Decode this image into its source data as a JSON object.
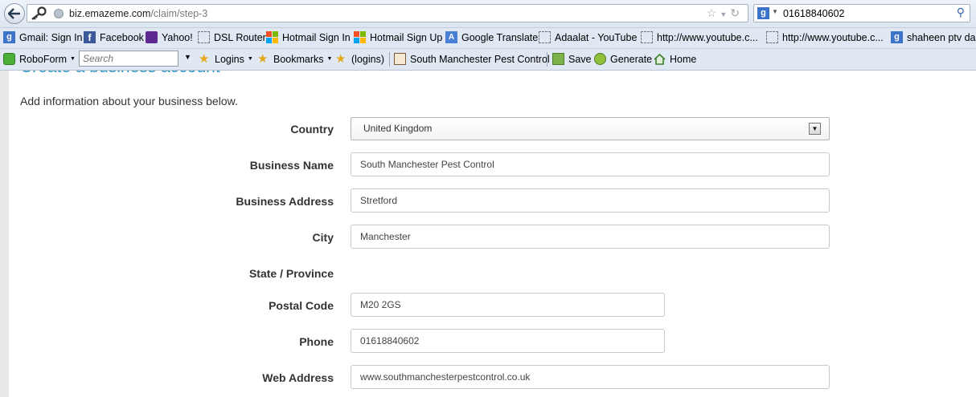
{
  "browser": {
    "url_host": "biz.emazeme.com",
    "url_path": "/claim/step-3",
    "search_value": "01618840602"
  },
  "bookmarks": [
    {
      "label": "Gmail: Sign In",
      "icon": "google-icon"
    },
    {
      "label": "Facebook",
      "icon": "facebook-icon"
    },
    {
      "label": "Yahoo!",
      "icon": "yahoo-icon"
    },
    {
      "label": "DSL Router",
      "icon": "page-icon"
    },
    {
      "label": "Hotmail Sign In",
      "icon": "windows-icon"
    },
    {
      "label": "Hotmail Sign Up",
      "icon": "windows-icon"
    },
    {
      "label": "Google Translate",
      "icon": "translate-icon"
    },
    {
      "label": "Adaalat - YouTube",
      "icon": "page-icon"
    },
    {
      "label": "http://www.youtube.c...",
      "icon": "page-icon"
    },
    {
      "label": "http://www.youtube.c...",
      "icon": "page-icon"
    },
    {
      "label": "shaheen ptv dar",
      "icon": "google-icon"
    }
  ],
  "roboform": {
    "label": "RoboForm",
    "search_placeholder": "Search",
    "logins": "Logins",
    "bookmarks": "Bookmarks",
    "logins_paren": "(logins)",
    "site": "South Manchester Pest Control",
    "save": "Save",
    "generate": "Generate",
    "home": "Home"
  },
  "page": {
    "title": "Create a business account",
    "intro": "Add information about your business below.",
    "fields": {
      "country_label": "Country",
      "country_value": "United Kingdom",
      "business_name_label": "Business Name",
      "business_name_value": "South Manchester Pest Control",
      "business_address_label": "Business Address",
      "business_address_value": "Stretford",
      "city_label": "City",
      "city_value": "Manchester",
      "state_label": "State / Province",
      "postal_label": "Postal Code",
      "postal_value": "M20 2GS",
      "phone_label": "Phone",
      "phone_value": "01618840602",
      "web_label": "Web Address",
      "web_value": "www.southmanchesterpestcontrol.co.uk"
    }
  },
  "colors": {
    "title_blue": "#2b95c6",
    "label_text": "#333333"
  }
}
